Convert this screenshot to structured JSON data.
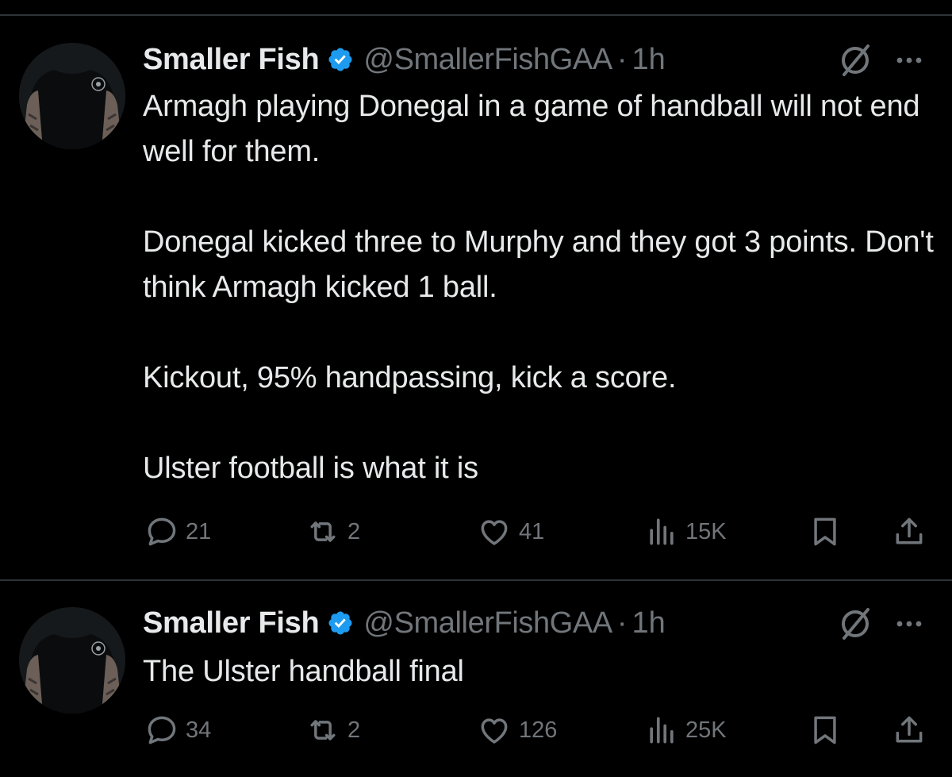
{
  "tweets": [
    {
      "author": {
        "name": "Smaller Fish",
        "handle": "@SmallerFishGAA",
        "separator": "·",
        "time": "1h",
        "verified": true
      },
      "text": [
        "Armagh playing Donegal in a game of handball will not end well for them.",
        "Donegal kicked three to Murphy and they got 3 points. Don't think Armagh kicked 1 ball.",
        "Kickout, 95% handpassing, kick a score.",
        "Ulster football is what it is"
      ],
      "stats": {
        "replies": "21",
        "reposts": "2",
        "likes": "41",
        "views": "15K"
      }
    },
    {
      "author": {
        "name": "Smaller Fish",
        "handle": "@SmallerFishGAA",
        "separator": "·",
        "time": "1h",
        "verified": true
      },
      "text": [
        "The Ulster handball final"
      ],
      "stats": {
        "replies": "34",
        "reposts": "2",
        "likes": "126",
        "views": "25K"
      }
    }
  ],
  "icons": {
    "verified": "verified-badge-icon",
    "grok": "grok-icon",
    "more": "more-icon",
    "reply": "reply-icon",
    "repost": "repost-icon",
    "like": "like-icon",
    "views": "views-icon",
    "bookmark": "bookmark-icon",
    "share": "share-icon"
  },
  "colors": {
    "background": "#000000",
    "text": "#e7e9ea",
    "muted": "#71767b",
    "verified": "#1d9bf0",
    "divider": "#2f3336"
  }
}
